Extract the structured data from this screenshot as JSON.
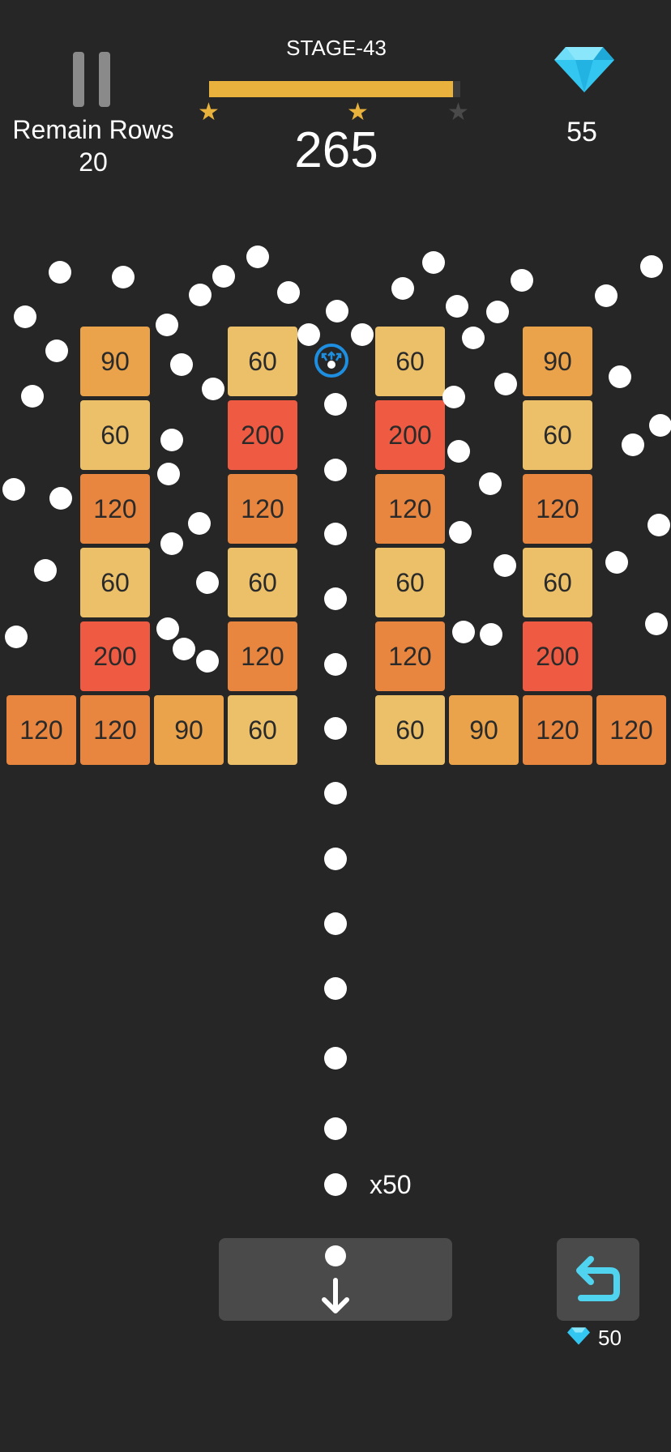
{
  "header": {
    "remain_label": "Remain Rows",
    "remain_rows": "20",
    "stage": "STAGE-43",
    "score": "265",
    "gems": "55",
    "progress_fraction": 0.97,
    "stars_earned": 2,
    "stars_total": 3
  },
  "board": {
    "ball_count_label": "x50",
    "colors": {
      "light": "#ecc069",
      "amber": "#eaa34a",
      "orange": "#e8853f",
      "red": "#ee5b42"
    },
    "bricks": [
      {
        "value": "90",
        "tone": "amber"
      },
      {
        "value": "60",
        "tone": "light"
      },
      {
        "value": "60",
        "tone": "light"
      },
      {
        "value": "90",
        "tone": "amber"
      },
      {
        "value": "60",
        "tone": "light"
      },
      {
        "value": "200",
        "tone": "red"
      },
      {
        "value": "200",
        "tone": "red"
      },
      {
        "value": "60",
        "tone": "light"
      },
      {
        "value": "120",
        "tone": "orange"
      },
      {
        "value": "120",
        "tone": "orange"
      },
      {
        "value": "120",
        "tone": "orange"
      },
      {
        "value": "120",
        "tone": "orange"
      },
      {
        "value": "60",
        "tone": "light"
      },
      {
        "value": "60",
        "tone": "light"
      },
      {
        "value": "60",
        "tone": "light"
      },
      {
        "value": "60",
        "tone": "light"
      },
      {
        "value": "200",
        "tone": "red"
      },
      {
        "value": "120",
        "tone": "orange"
      },
      {
        "value": "120",
        "tone": "orange"
      },
      {
        "value": "200",
        "tone": "red"
      },
      {
        "value": "120",
        "tone": "orange"
      },
      {
        "value": "120",
        "tone": "orange"
      },
      {
        "value": "90",
        "tone": "amber"
      },
      {
        "value": "60",
        "tone": "light"
      },
      {
        "value": "60",
        "tone": "light"
      },
      {
        "value": "90",
        "tone": "amber"
      },
      {
        "value": "120",
        "tone": "orange"
      },
      {
        "value": "120",
        "tone": "orange"
      }
    ]
  },
  "controls": {
    "undo_cost": "50",
    "gem_color": "#33c6f0",
    "undo_icon_color": "#4fd3ee",
    "launcher_color": "#1e8ee0"
  }
}
